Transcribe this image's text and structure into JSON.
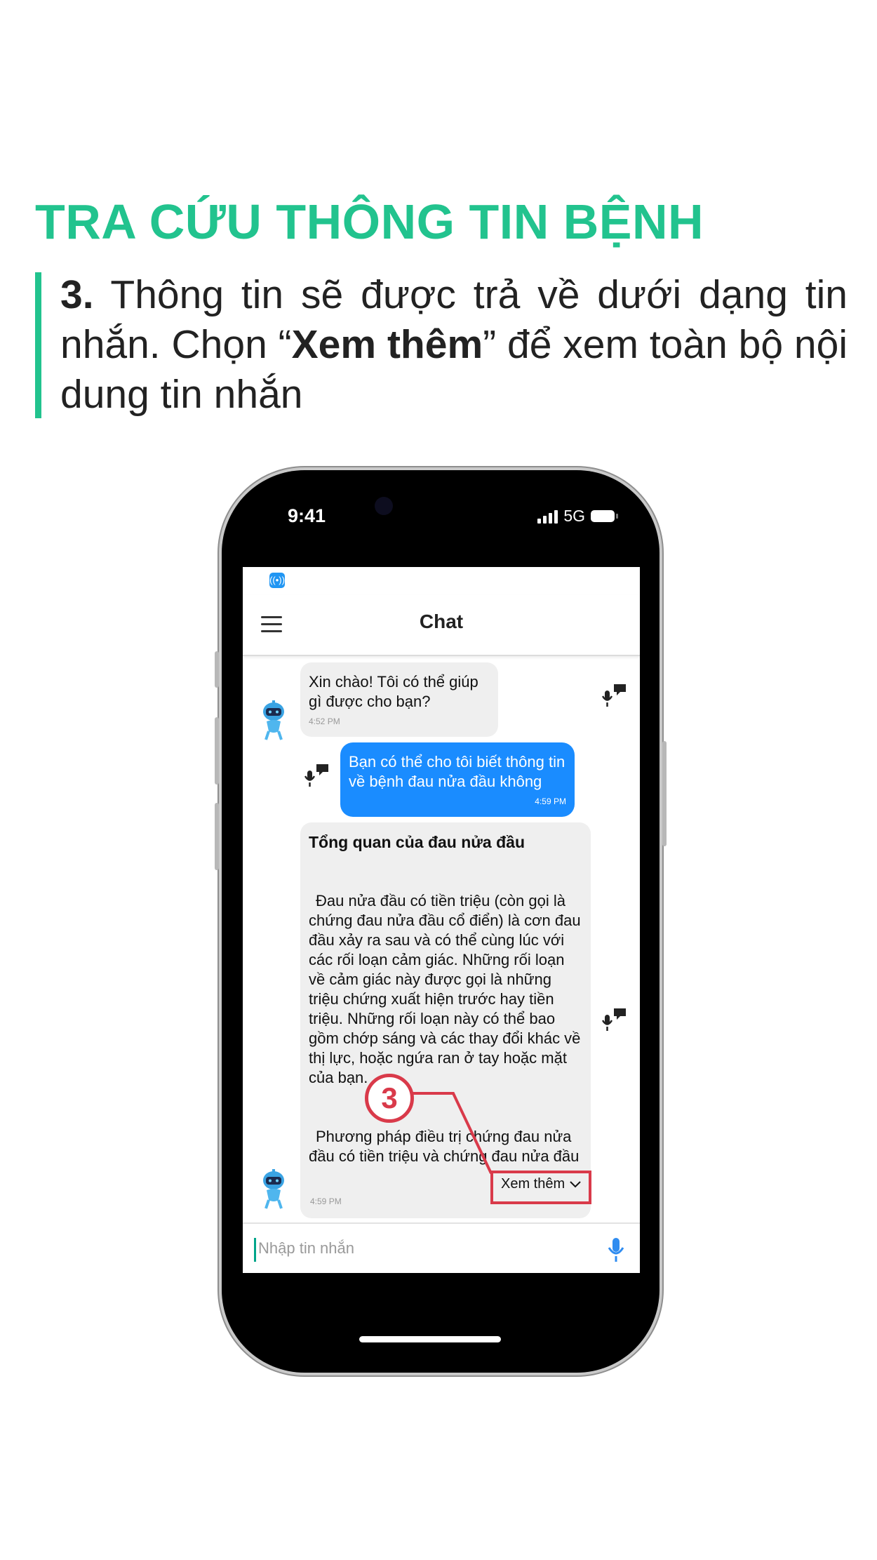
{
  "heading": "TRA CỨU THÔNG TIN BỆNH",
  "instruction": {
    "step": "3.",
    "text_before": " Thông tin sẽ được trả về dưới dạng  tin nhắn. Chọn “",
    "highlight": "Xem thêm",
    "text_after": "” để xem toàn bộ nội dung tin nhắn"
  },
  "status_bar": {
    "time": "9:41",
    "network": "5G"
  },
  "app": {
    "title": "Chat"
  },
  "messages": [
    {
      "sender": "bot",
      "text": "Xin chào! Tôi có thể giúp gì được cho bạn?",
      "time": "4:52 PM"
    },
    {
      "sender": "user",
      "text": "Bạn có thể cho tôi biết thông tin về bệnh đau nửa đầu không",
      "time": "4:59 PM"
    },
    {
      "sender": "bot",
      "title": "Tổng quan của đau nửa đầu",
      "paragraph1": "Đau nửa đầu có tiền triệu (còn gọi là chứng đau nửa đầu cổ điển) là cơn đau đầu xảy ra sau và có thể cùng lúc với các rối loạn cảm giác. Những rối loạn về cảm giác này được gọi là những triệu chứng xuất hiện trước hay tiền triệu. Những rối loạn này có thể bao gồm chớp sáng và các thay đổi khác về thị lực, hoặc ngứa ran ở tay hoặc mặt của bạn.",
      "paragraph2": "Phương pháp điều trị chứng đau nửa đầu có tiền triệu và chứng đau nửa đầu không có tiền triệu (còn gọi là chứng đau",
      "more_label": "Xem thêm",
      "time": "4:59 PM"
    }
  ],
  "input": {
    "placeholder": "Nhập tin nhắn"
  },
  "callout": {
    "number": "3"
  },
  "colors": {
    "accent": "#22c38e",
    "user_bubble": "#1a8cff",
    "callout": "#d93a4a"
  },
  "icons": [
    "app-icon",
    "menu-icon",
    "bot-avatar-icon",
    "mic-feedback-icon",
    "chevron-down-icon",
    "mic-icon"
  ]
}
